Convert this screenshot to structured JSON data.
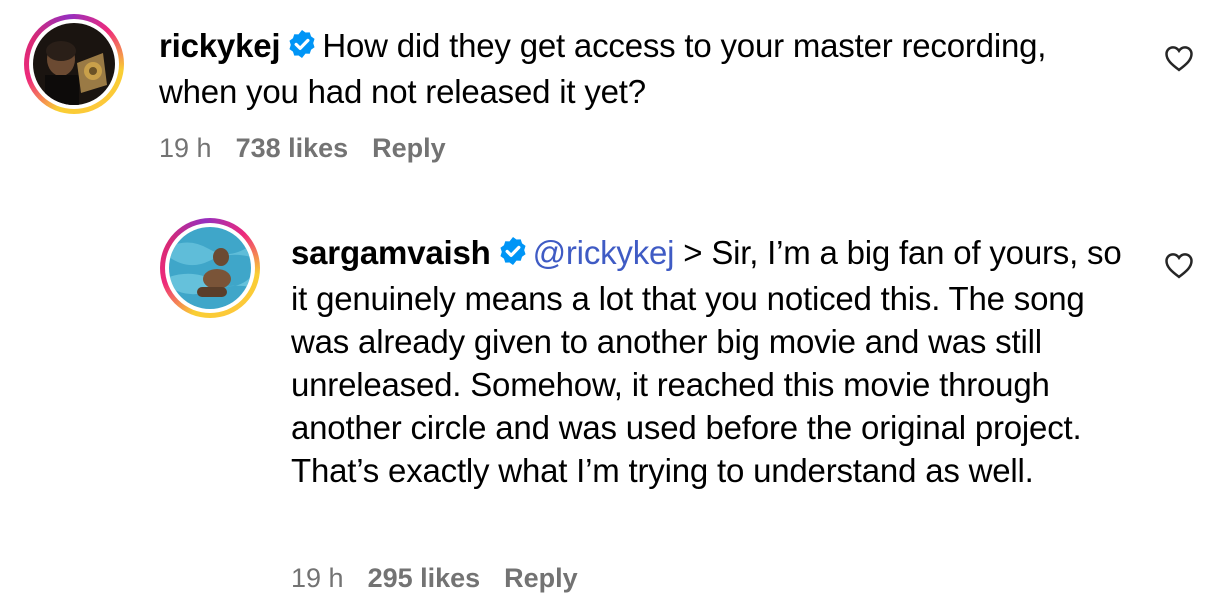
{
  "comments": [
    {
      "username": "rickykej",
      "mention": "",
      "text": "How did they get access to your master recording, when you had not released it yet?",
      "time": "19 h",
      "likes": "738 likes",
      "reply_label": "Reply"
    },
    {
      "username": "sargamvaish",
      "mention": "@rickykej",
      "text": "> Sir, I’m a big fan of yours, so it genuinely means a lot that you noticed this. The song was already given to another big movie and was still unreleased. Somehow, it reached this movie through another circle and was used before the original project. That’s exactly what I’m trying to understand as well.",
      "time": "19 h",
      "likes": "295 likes",
      "reply_label": "Reply"
    }
  ],
  "icons": {
    "verified": "verified-badge-icon",
    "like": "heart-icon"
  },
  "colors": {
    "verified": "#0095f6",
    "mention": "#3f5bc4",
    "meta": "#737373"
  }
}
